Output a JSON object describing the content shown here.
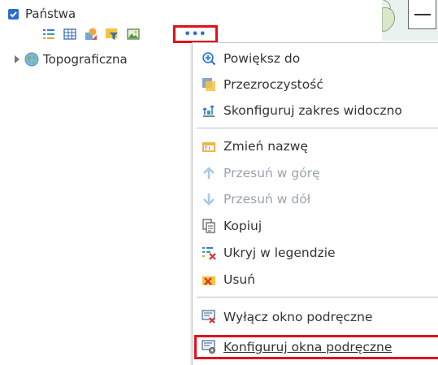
{
  "layers": [
    {
      "label": "Państwa",
      "checked": true
    },
    {
      "label": "Topograficzna"
    }
  ],
  "toolbar": {
    "icons": [
      "table-list-icon",
      "attribute-table-icon",
      "symbology-icon",
      "filter-icon",
      "image-icon"
    ],
    "more_label": "•••"
  },
  "menu": {
    "items": [
      {
        "label": "Powiększ do",
        "icon": "zoom-to-icon",
        "enabled": true
      },
      {
        "label": "Przezroczystość",
        "icon": "transparency-icon",
        "enabled": true
      },
      {
        "label": "Skonfiguruj zakres widoczno",
        "icon": "visibility-range-icon",
        "enabled": true
      },
      {
        "label": "Zmień nazwę",
        "icon": "rename-icon",
        "enabled": true
      },
      {
        "label": "Przesuń w górę",
        "icon": "arrow-up-icon",
        "enabled": false
      },
      {
        "label": "Przesuń w dół",
        "icon": "arrow-down-icon",
        "enabled": false
      },
      {
        "label": "Kopiuj",
        "icon": "copy-icon",
        "enabled": true
      },
      {
        "label": "Ukryj w legendzie",
        "icon": "hide-legend-icon",
        "enabled": true
      },
      {
        "label": "Usuń",
        "icon": "remove-icon",
        "enabled": true
      },
      {
        "label": "Wyłącz okno podręczne",
        "icon": "disable-popup-icon",
        "enabled": true
      },
      {
        "label": "Konfiguruj okna podręczne",
        "icon": "configure-popup-icon",
        "enabled": true
      }
    ]
  },
  "colors": {
    "accent": "#2b6cd6",
    "highlight": "#e0121b",
    "disabled": "#9aa3ad"
  }
}
